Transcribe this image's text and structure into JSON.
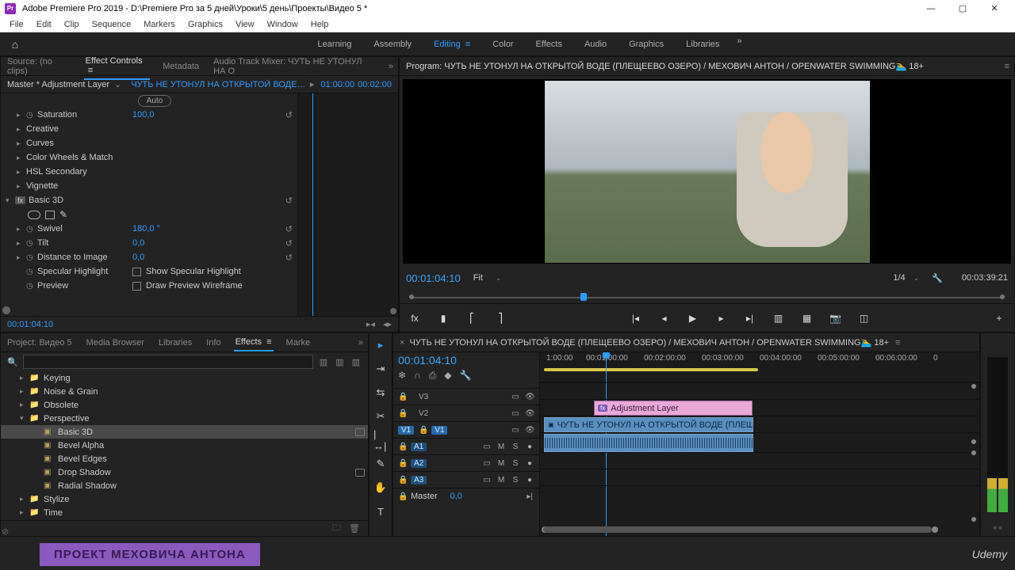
{
  "title": "Adobe Premiere Pro 2019 - D:\\Premiere Pro за 5 дней\\Уроки\\5 день\\Проекты\\Видео 5 *",
  "menu": [
    "File",
    "Edit",
    "Clip",
    "Sequence",
    "Markers",
    "Graphics",
    "View",
    "Window",
    "Help"
  ],
  "workspaces": [
    "Learning",
    "Assembly",
    "Editing",
    "Color",
    "Effects",
    "Audio",
    "Graphics",
    "Libraries"
  ],
  "active_workspace": "Editing",
  "source_tabs": [
    "Source: (no clips)",
    "Effect Controls",
    "Metadata",
    "Audio Track Mixer: ЧУТЬ НЕ УТОНУЛ НА О"
  ],
  "ec": {
    "master": "Master * Adjustment Layer",
    "sequence": "ЧУТЬ НЕ УТОНУЛ НА ОТКРЫТОЙ ВОДЕ (ПЛЕ...",
    "start_tc": "01:00:00",
    "end_tc": "00:02:00",
    "auto": "Auto",
    "rows": {
      "saturation": "Saturation",
      "saturation_v": "100,0",
      "creative": "Creative",
      "curves": "Curves",
      "cwm": "Color Wheels & Match",
      "hsl": "HSL Secondary",
      "vignette": "Vignette",
      "basic3d": "Basic 3D",
      "swivel": "Swivel",
      "swivel_v": "180,0 °",
      "tilt": "Tilt",
      "tilt_v": "0,0",
      "dist": "Distance to Image",
      "dist_v": "0,0",
      "spec": "Specular Highlight",
      "spec_opt": "Show Specular Highlight",
      "prev": "Preview",
      "prev_opt": "Draw Preview Wireframe"
    },
    "current_tc": "00:01:04:10"
  },
  "program": {
    "title": "Program: ЧУТЬ НЕ УТОНУЛ НА ОТКРЫТОЙ ВОДЕ (ПЛЕЩЕЕВО ОЗЕРО) / МЕХОВИЧ АНТОН / OPENWATER SWIMMING🏊‍♂️ 18+",
    "tc": "00:01:04:10",
    "fit": "Fit",
    "scale": "1/4",
    "dur": "00:03:39:21"
  },
  "project_tabs": [
    "Project: Видео 5",
    "Media Browser",
    "Libraries",
    "Info",
    "Effects",
    "Marke"
  ],
  "effects": {
    "search_placeholder": "",
    "list": [
      {
        "ind": 1,
        "tw": "▸",
        "ic": "📁",
        "nm": "Keying"
      },
      {
        "ind": 1,
        "tw": "▸",
        "ic": "📁",
        "nm": "Noise & Grain"
      },
      {
        "ind": 1,
        "tw": "▸",
        "ic": "📁",
        "nm": "Obsolete"
      },
      {
        "ind": 1,
        "tw": "▾",
        "ic": "📁",
        "nm": "Perspective"
      },
      {
        "ind": 2,
        "tw": "",
        "ic": "▣",
        "nm": "Basic 3D",
        "sel": true,
        "box": true
      },
      {
        "ind": 2,
        "tw": "",
        "ic": "▣",
        "nm": "Bevel Alpha"
      },
      {
        "ind": 2,
        "tw": "",
        "ic": "▣",
        "nm": "Bevel Edges"
      },
      {
        "ind": 2,
        "tw": "",
        "ic": "▣",
        "nm": "Drop Shadow",
        "box": true
      },
      {
        "ind": 2,
        "tw": "",
        "ic": "▣",
        "nm": "Radial Shadow"
      },
      {
        "ind": 1,
        "tw": "▸",
        "ic": "📁",
        "nm": "Stylize"
      },
      {
        "ind": 1,
        "tw": "▸",
        "ic": "📁",
        "nm": "Time"
      }
    ]
  },
  "timeline": {
    "name": "ЧУТЬ НЕ УТОНУЛ НА ОТКРЫТОЙ ВОДЕ (ПЛЕЩЕЕВО ОЗЕРО) / МЕХОВИЧ АНТОН / OPENWATER SWIMMING🏊‍♂️ 18+",
    "tc": "00:01:04:10",
    "ruler": [
      "1:00:00",
      "00:01:00:00",
      "00:02:00:00",
      "00:03:00:00",
      "00:04:00:00",
      "00:05:00:00",
      "00:06:00:00",
      "0"
    ],
    "tracks": {
      "v3": "V3",
      "v2": "V2",
      "v1": "V1",
      "a1": "A1",
      "a2": "A2",
      "a3": "A3",
      "master": "Master",
      "master_v": "0,0"
    },
    "clip_adj": "Adjustment Layer",
    "clip_vid": "ЧУТЬ НЕ УТОНУЛ НА ОТКРЫТОЙ ВОДЕ (ПЛЕЩЕЕВО ОЗЕРО) / МЕХО",
    "mute": "M",
    "solo": "S"
  },
  "watermark": "ПРОЕКТ МЕХОВИЧА АНТОНА",
  "udemy": "Udemy"
}
